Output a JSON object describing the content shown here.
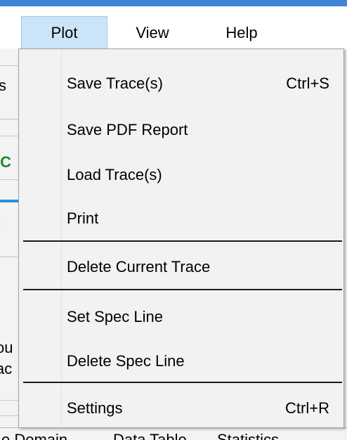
{
  "menubar": {
    "items": [
      {
        "label": "Plot",
        "active": true
      },
      {
        "label": "View",
        "active": false
      },
      {
        "label": "Help",
        "active": false
      }
    ]
  },
  "plot_menu": {
    "items": [
      {
        "label": "Save Trace(s)",
        "shortcut": "Ctrl+S"
      },
      {
        "label": "Save PDF Report",
        "shortcut": ""
      },
      {
        "label": "Load Trace(s)",
        "shortcut": ""
      },
      {
        "label": "Print",
        "shortcut": ""
      },
      {
        "label": "Delete Current Trace",
        "shortcut": ""
      },
      {
        "label": "Set Spec Line",
        "shortcut": ""
      },
      {
        "label": "Delete Spec Line",
        "shortcut": ""
      },
      {
        "label": "Settings",
        "shortcut": "Ctrl+R"
      }
    ]
  },
  "background": {
    "left_fragments": [
      "s",
      "IC",
      "é",
      "ou",
      "ac"
    ],
    "bottom_tabs": [
      "e Domain",
      "Data Table",
      "Statistics"
    ]
  },
  "colors": {
    "title_bar": "#3f84d6",
    "menu_active_bg": "#cce4f7",
    "menu_active_border": "#99c7eb",
    "menu_bg": "#f2f2f2",
    "fragment_green": "#1c8a2c"
  }
}
